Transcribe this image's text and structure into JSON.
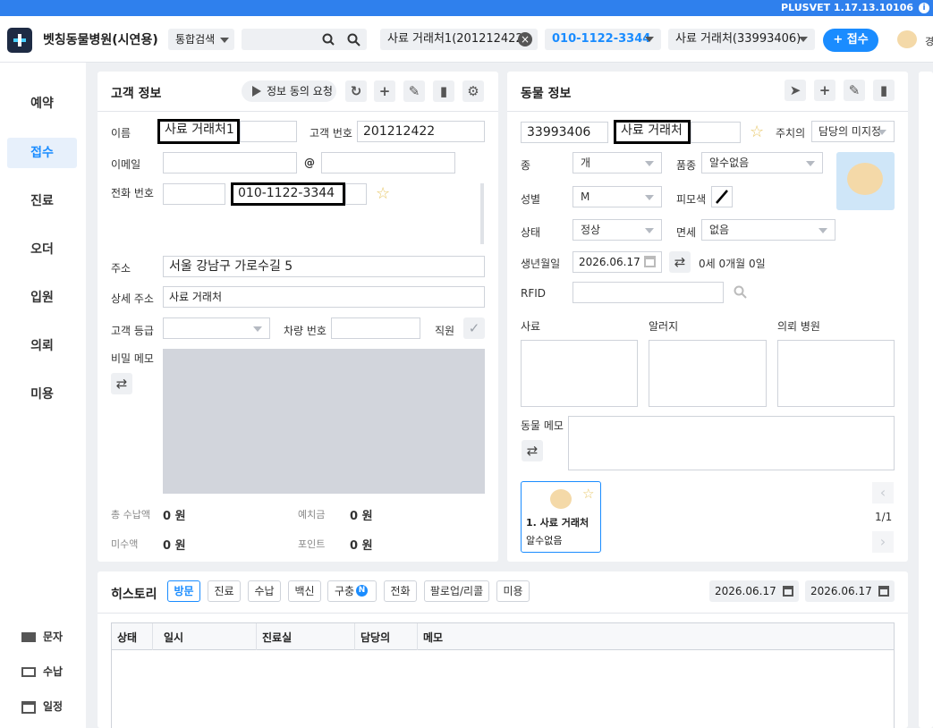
{
  "version": "PLUSVET 1.17.13.10106",
  "hospital": "벳칭동물병원(시연용)",
  "search": {
    "mode": "통합검색"
  },
  "open_tabs": [
    {
      "label": "사료 거래처1(201212422)"
    },
    {
      "label": "010-1122-3344"
    },
    {
      "label": "사료 거래처(33993406)"
    }
  ],
  "reception_btn": "+ 접수",
  "user_initial": "경",
  "nav": [
    "예약",
    "접수",
    "진료",
    "오더",
    "입원",
    "의뢰",
    "미용"
  ],
  "nav_bottom": [
    "문자",
    "수납",
    "일정"
  ],
  "customer": {
    "title": "고객 정보",
    "consent_btn": "정보 동의 요청",
    "name_label": "이름",
    "name": "사료 거래처1",
    "id_label": "고객 번호",
    "id": "201212422",
    "email_label": "이메일",
    "at": "@",
    "phone_label": "전화 번호",
    "phone": "010-1122-3344",
    "address_label": "주소",
    "address": "서울 강남구 가로수길 5",
    "detail_label": "상세 주소",
    "detail": "사료 거래처",
    "grade_label": "고객 등급",
    "car_label": "차량 번호",
    "staff_label": "직원",
    "memo_label": "비밀 메모",
    "total_label": "총 수납액",
    "total": "0 원",
    "deposit_label": "예치금",
    "deposit": "0 원",
    "unpaid_label": "미수액",
    "unpaid": "0 원",
    "point_label": "포인트",
    "point": "0 원"
  },
  "animal": {
    "title": "동물 정보",
    "id": "33993406",
    "name": "사료 거래처",
    "vet_label": "주치의",
    "vet": "담당의 미지정",
    "species_label": "종",
    "species": "개",
    "breed_label": "품종",
    "breed": "알수없음",
    "sex_label": "성별",
    "sex": "M",
    "color_label": "피모색",
    "status_label": "상태",
    "status": "정상",
    "immunity_label": "면세",
    "immunity": "없음",
    "birth_label": "생년월일",
    "birth": "2026.06.17",
    "age": "0세 0개월 0일",
    "rfid_label": "RFID",
    "feed_label": "사료",
    "allergy_label": "알러지",
    "referral_label": "의뢰 병원",
    "memo_label": "동물 메모",
    "card_name": "1. 사료 거래처",
    "card_breed": "알수없음",
    "page": "1/1"
  },
  "history": {
    "title": "히스토리",
    "tabs": [
      "방문",
      "진료",
      "수납",
      "백신",
      "구충",
      "전화",
      "팔로업/리콜",
      "미용"
    ],
    "badge": "N",
    "date_from": "2026.06.17",
    "date_to": "2026.06.17",
    "columns": [
      "상태",
      "일시",
      "진료실",
      "담당의",
      "메모"
    ]
  }
}
